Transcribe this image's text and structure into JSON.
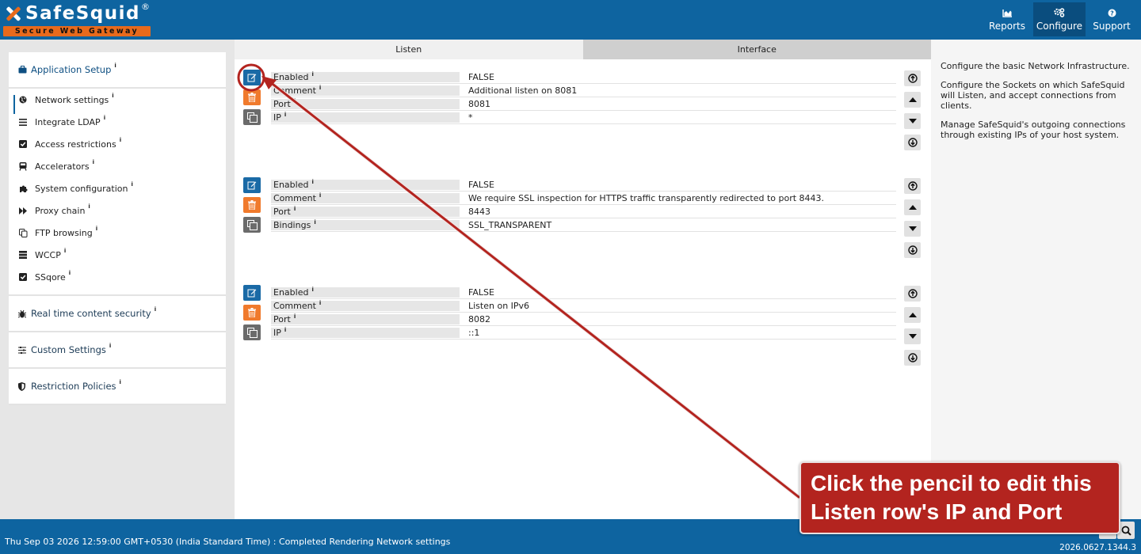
{
  "brand": {
    "name": "SafeSquid",
    "registered": "®",
    "tagline": "Secure Web Gateway"
  },
  "nav": [
    {
      "label": "Reports",
      "icon": "area-chart-icon",
      "active": false
    },
    {
      "label": "Configure",
      "icon": "gears-icon",
      "active": true
    },
    {
      "label": "Support",
      "icon": "question-icon",
      "active": false
    }
  ],
  "sidebar": {
    "app_setup": {
      "label": "Application Setup",
      "icon": "briefcase-icon"
    },
    "items": [
      {
        "label": "Network settings",
        "icon": "globe-icon",
        "active": true
      },
      {
        "label": "Integrate LDAP",
        "icon": "bars-icon"
      },
      {
        "label": "Access restrictions",
        "icon": "check-square-icon"
      },
      {
        "label": "Accelerators",
        "icon": "train-icon"
      },
      {
        "label": "System configuration",
        "icon": "puzzle-icon"
      },
      {
        "label": "Proxy chain",
        "icon": "forward-icon"
      },
      {
        "label": "FTP browsing",
        "icon": "copy-icon"
      },
      {
        "label": "WCCP",
        "icon": "server-icon"
      },
      {
        "label": "SSqore",
        "icon": "check-square-icon"
      }
    ],
    "sections": [
      {
        "label": "Real time content security",
        "icon": "bug-icon"
      },
      {
        "label": "Custom Settings",
        "icon": "sliders-icon"
      },
      {
        "label": "Restriction Policies",
        "icon": "shield-icon"
      }
    ],
    "info_mark": "i"
  },
  "tabs": [
    {
      "label": "Listen",
      "active": true
    },
    {
      "label": "Interface",
      "active": false
    }
  ],
  "entries": [
    {
      "fields": [
        {
          "key": "Enabled",
          "value": "FALSE"
        },
        {
          "key": "Comment",
          "value": "Additional listen on 8081"
        },
        {
          "key": "Port",
          "value": "8081"
        },
        {
          "key": "IP",
          "value": "*"
        }
      ]
    },
    {
      "fields": [
        {
          "key": "Enabled",
          "value": "FALSE"
        },
        {
          "key": "Comment",
          "value": "We require SSL inspection for HTTPS traffic transparently redirected to port 8443."
        },
        {
          "key": "Port",
          "value": "8443"
        },
        {
          "key": "Bindings",
          "value": "SSL_TRANSPARENT"
        }
      ]
    },
    {
      "fields": [
        {
          "key": "Enabled",
          "value": "FALSE"
        },
        {
          "key": "Comment",
          "value": "Listen on IPv6"
        },
        {
          "key": "Port",
          "value": "8082"
        },
        {
          "key": "IP",
          "value": "::1"
        }
      ]
    }
  ],
  "help": [
    "Configure the basic Network Infrastructure.",
    "Configure the Sockets on which SafeSquid will Listen, and accept connections from clients.",
    "Manage SafeSquid's outgoing connections through existing IPs of your host system."
  ],
  "footer": {
    "status": "Thu Sep 03 2026 12:59:00 GMT+0530 (India Standard Time) : Completed Rendering Network settings",
    "version": "2026.0627.1344.3"
  },
  "annotation": {
    "text": "Click the pencil to edit this Listen row's IP and Port",
    "color": "#b3241f"
  },
  "colors": {
    "header": "#0e64a0",
    "edit": "#1a6aa6",
    "delete": "#f07a2c",
    "copy": "#6b6b6b"
  }
}
